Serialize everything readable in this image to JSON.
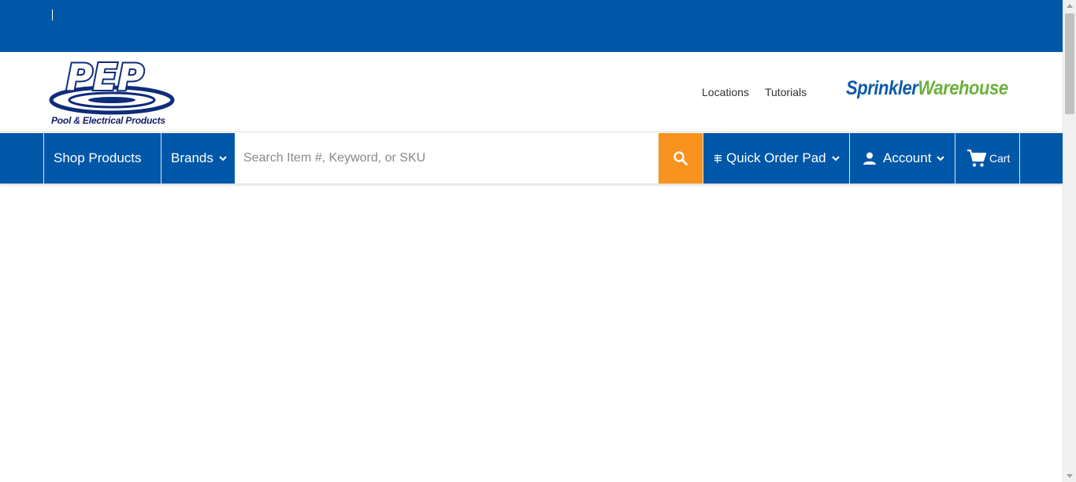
{
  "top_bar": {
    "divider": "|"
  },
  "header": {
    "logo": {
      "name": "PEP",
      "caption": "Pool & Electrical Products"
    },
    "links": [
      "Locations",
      "Tutorials"
    ],
    "partner_logo": {
      "part1": "Sprinkler",
      "part2": "Warehouse"
    }
  },
  "nav": {
    "shop_products": "Shop Products",
    "brands": "Brands",
    "search": {
      "placeholder": "Search Item #, Keyword, or SKU",
      "value": ""
    },
    "quick_order_pad": "Quick Order Pad",
    "account": "Account",
    "cart": "Cart"
  },
  "colors": {
    "brand_blue": "#0057a8",
    "accent_orange": "#f7931e",
    "partner_green": "#6bb23c"
  },
  "icons": [
    "chevron-down-icon",
    "search-icon",
    "list-icon",
    "user-icon",
    "cart-icon"
  ]
}
